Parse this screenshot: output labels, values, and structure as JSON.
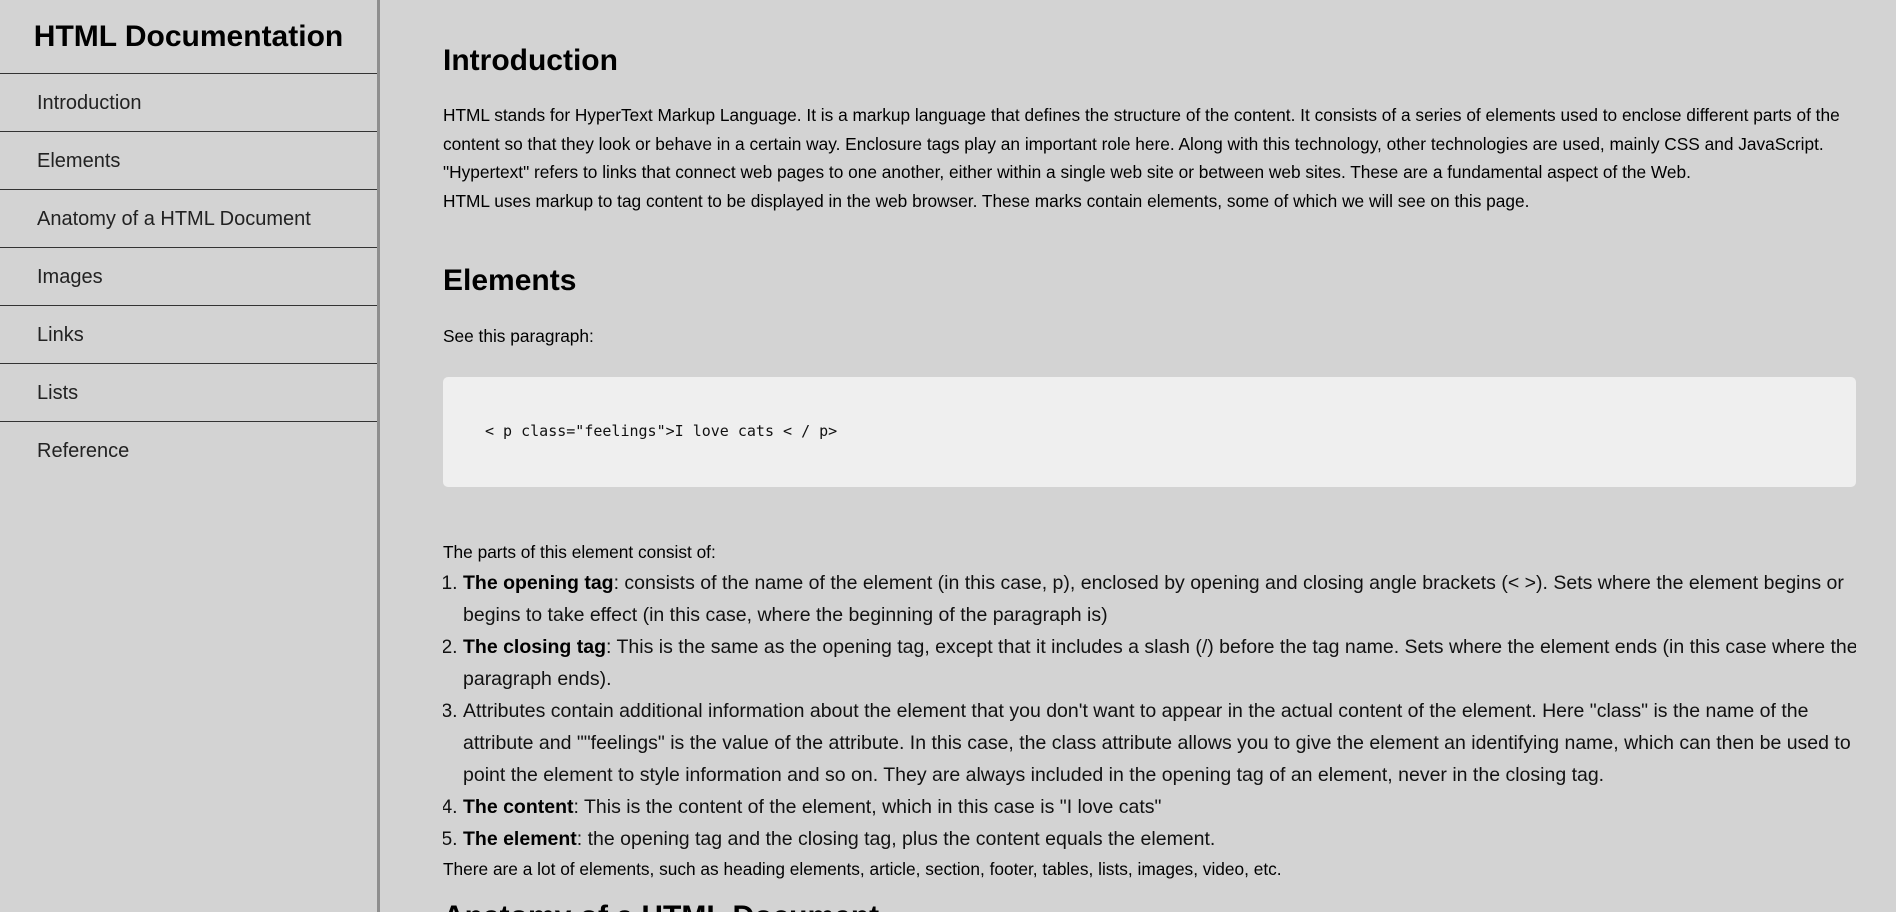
{
  "navbar": {
    "title": "HTML Documentation",
    "links": [
      "Introduction",
      "Elements",
      "Anatomy of a HTML Document",
      "Images",
      "Links",
      "Lists",
      "Reference"
    ]
  },
  "main": {
    "introduction": {
      "heading": "Introduction",
      "paragraphs": [
        "HTML stands for HyperText Markup Language. It is a markup language that defines the structure of the content. It consists of a series of elements used to enclose different parts of the content so that they look or behave in a certain way. Enclosure tags play an important role here. Along with this technology, other technologies are used, mainly CSS and JavaScript.",
        "\"Hypertext\" refers to links that connect web pages to one another, either within a single web site or between web sites. These are a fundamental aspect of the Web.",
        "HTML uses markup to tag content to be displayed in the web browser. These marks contain elements, some of which we will see on this page."
      ]
    },
    "elements": {
      "heading": "Elements",
      "see_paragraph": "See this paragraph:",
      "code": "< p class=\"feelings\">I love cats < / p>",
      "parts_intro": "The parts of this element consist of:",
      "parts": [
        {
          "term": "The opening tag",
          "text": ": consists of the name of the element (in this case, p), enclosed by opening and closing angle brackets (< >). Sets where the element begins or begins to take effect (in this case, where the beginning of the paragraph is)"
        },
        {
          "term": "The closing tag",
          "text": ": This is the same as the opening tag, except that it includes a slash (/) before the tag name. Sets where the element ends (in this case where the paragraph ends)."
        },
        {
          "term": "",
          "text": "Attributes contain additional information about the element that you don't want to appear in the actual content of the element. Here \"class\" is the name of the attribute and \"\"feelings\" is the value of the attribute. In this case, the class attribute allows you to give the element an identifying name, which can then be used to point the element to style information and so on. They are always included in the opening tag of an element, never in the closing tag."
        },
        {
          "term": "The content",
          "text": ": This is the content of the element, which in this case is \"I love cats\""
        },
        {
          "term": "The element",
          "text": ": the opening tag and the closing tag, plus the content equals the element."
        }
      ],
      "closing_paragraph": "There are a lot of elements, such as heading elements, article, section, footer, tables, lists, images, video, etc."
    },
    "anatomy": {
      "heading": "Anatomy of a HTML Document"
    }
  }
}
